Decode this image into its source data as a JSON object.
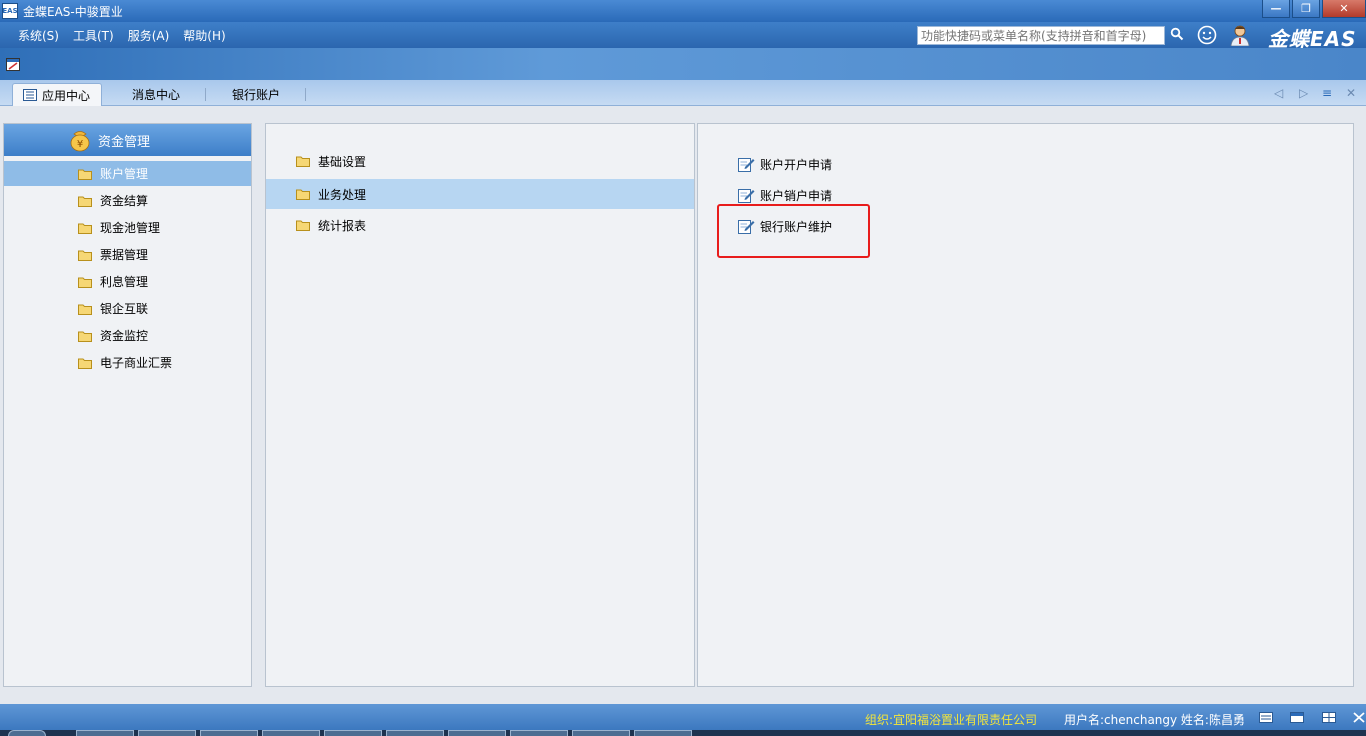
{
  "window": {
    "title": "金蝶EAS-中骏置业",
    "app_icon": "EAS"
  },
  "menu": {
    "items": [
      "系统(S)",
      "工具(T)",
      "服务(A)",
      "帮助(H)"
    ],
    "search_placeholder": "功能快捷码或菜单名称(支持拼音和首字母)",
    "brand": "金蝶EAS"
  },
  "tabs": {
    "items": [
      "应用中心",
      "消息中心",
      "银行账户"
    ],
    "active_index": 0
  },
  "left_nav": {
    "header": "资金管理",
    "items": [
      "账户管理",
      "资金结算",
      "现金池管理",
      "票据管理",
      "利息管理",
      "银企互联",
      "资金监控",
      "电子商业汇票"
    ],
    "selected_index": 0
  },
  "middle_nav": {
    "items": [
      "基础设置",
      "业务处理",
      "统计报表"
    ],
    "selected_index": 1
  },
  "functions": {
    "items": [
      "账户开户申请",
      "账户销户申请",
      "银行账户维护"
    ],
    "highlighted_index": 2
  },
  "status": {
    "org": "组织:宜阳福浴置业有限责任公司",
    "user": "用户名:chenchangy 姓名:陈昌勇"
  },
  "colors": {
    "accent": "#3d7ec8",
    "highlight": "#e81c1c",
    "selected_row": "#8fbce7"
  }
}
